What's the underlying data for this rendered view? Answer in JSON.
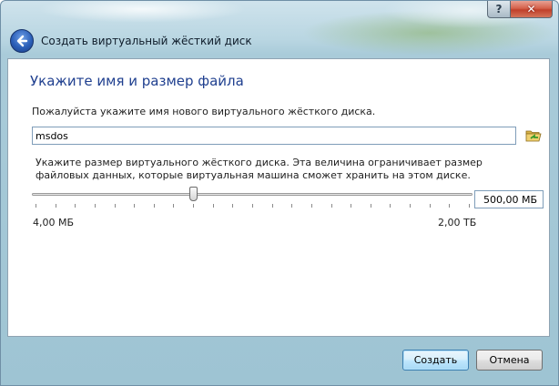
{
  "window": {
    "title": "Создать виртуальный жёсткий диск",
    "caption_help": "?",
    "caption_close": "✕"
  },
  "page": {
    "heading": "Укажите имя и размер файла",
    "name_prompt": "Пожалуйста укажите имя нового виртуального жёсткого диска.",
    "name_value": "msdos",
    "size_prompt": "Укажите размер виртуального жёсткого диска. Эта величина ограничивает размер файловых данных, которые виртуальная машина сможет хранить на этом диске.",
    "size_value": "500,00 МБ",
    "slider_fraction": 0.365,
    "min_label": "4,00 МБ",
    "max_label": "2,00 ТБ"
  },
  "buttons": {
    "create": "Создать",
    "cancel": "Отмена"
  },
  "icons": {
    "back": "back-arrow-icon",
    "folder": "open-folder-icon"
  },
  "colors": {
    "heading": "#1f3f8f",
    "accent_border": "#3c7fb1"
  }
}
